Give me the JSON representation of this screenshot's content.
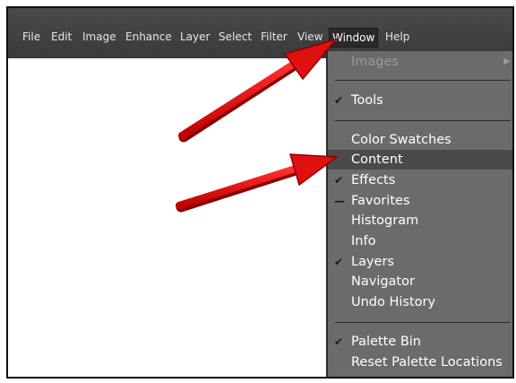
{
  "menubar": {
    "items": [
      "File",
      "Edit",
      "Image",
      "Enhance",
      "Layer",
      "Select",
      "Filter",
      "View",
      "Window",
      "Help"
    ],
    "active": "Window"
  },
  "window_menu": {
    "items": [
      {
        "label": "Images",
        "state": "disabled",
        "submenu": true
      },
      {
        "label": "Tools",
        "mark": "check"
      },
      {
        "label": "Color Swatches"
      },
      {
        "label": "Content",
        "highlight": true
      },
      {
        "label": "Effects",
        "mark": "check"
      },
      {
        "label": "Favorites",
        "mark": "dash"
      },
      {
        "label": "Histogram"
      },
      {
        "label": "Info"
      },
      {
        "label": "Layers",
        "mark": "check"
      },
      {
        "label": "Navigator"
      },
      {
        "label": "Undo History"
      },
      {
        "label": "Palette Bin",
        "mark": "check"
      },
      {
        "label": "Reset Palette Locations"
      }
    ]
  },
  "colors": {
    "menubar": "#3f3f3f",
    "dropdown": "#6b6b6b",
    "highlight": "#4a4a4a",
    "arrow": "#e01010"
  }
}
